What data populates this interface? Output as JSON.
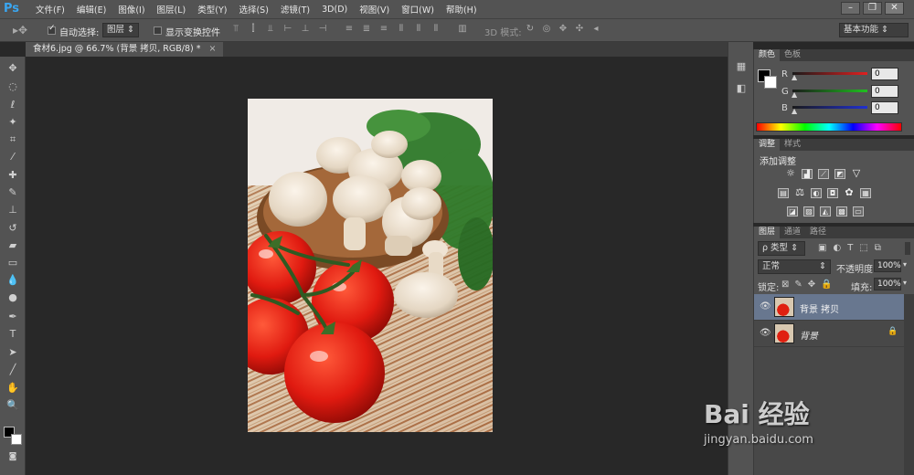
{
  "app": {
    "logo": "Ps"
  },
  "menu": [
    "文件(F)",
    "编辑(E)",
    "图像(I)",
    "图层(L)",
    "类型(Y)",
    "选择(S)",
    "滤镜(T)",
    "3D(D)",
    "视图(V)",
    "窗口(W)",
    "帮助(H)"
  ],
  "window_controls": [
    "–",
    "❐",
    "✕"
  ],
  "options": {
    "auto_select_label": "自动选择:",
    "auto_select_target": "图层",
    "show_transform_label": "显示变换控件",
    "mode_3d_label": "3D 模式:",
    "workspace": "基本功能"
  },
  "document_tab": {
    "title": "食材6.jpg @ 66.7% (背景 拷贝, RGB/8) *",
    "close": "×"
  },
  "color_panel": {
    "tabs": [
      "颜色",
      "色板"
    ],
    "channels": [
      {
        "label": "R",
        "value": "0",
        "color": "#e02020"
      },
      {
        "label": "G",
        "value": "0",
        "color": "#20c020"
      },
      {
        "label": "B",
        "value": "0",
        "color": "#2030d0"
      }
    ]
  },
  "adjust_panel": {
    "tabs": [
      "调整",
      "样式"
    ],
    "title": "添加调整"
  },
  "layers_panel": {
    "tabs": [
      "图层",
      "通道",
      "路径"
    ],
    "filter_kind": "ρ 类型",
    "blend_mode": "正常",
    "opacity_label": "不透明度:",
    "opacity": "100%",
    "lock_label": "锁定:",
    "fill_label": "填充:",
    "fill": "100%",
    "layers": [
      {
        "name": "背景 拷贝",
        "selected": true,
        "locked": false
      },
      {
        "name": "背景",
        "selected": false,
        "locked": true
      }
    ]
  },
  "watermark": {
    "brand": "Bai 经验",
    "url": "jingyan.baidu.com"
  }
}
